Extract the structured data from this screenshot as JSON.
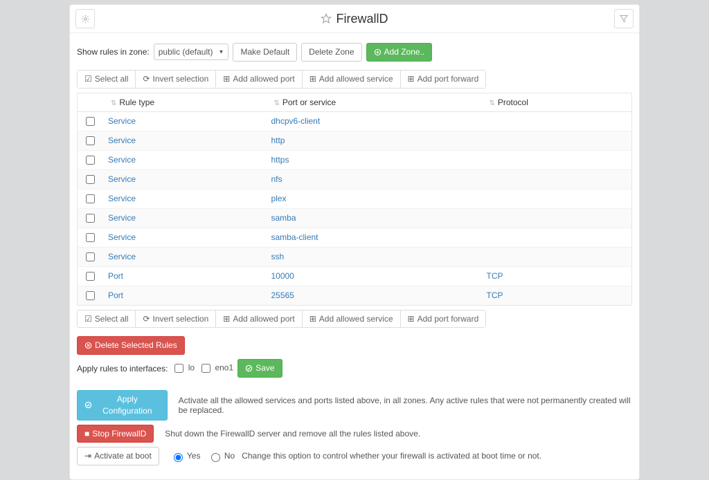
{
  "title": "FirewallD",
  "zone_label": "Show rules in zone:",
  "zone_value": "public (default)",
  "make_default": "Make Default",
  "delete_zone": "Delete Zone",
  "add_zone": "Add Zone..",
  "toolbar": {
    "select_all": "Select all",
    "invert": "Invert selection",
    "add_port": "Add allowed port",
    "add_service": "Add allowed service",
    "add_forward": "Add port forward"
  },
  "columns": {
    "rule_type": "Rule type",
    "port_service": "Port or service",
    "protocol": "Protocol"
  },
  "rules": [
    {
      "type": "Service",
      "value": "dhcpv6-client",
      "proto": ""
    },
    {
      "type": "Service",
      "value": "http",
      "proto": ""
    },
    {
      "type": "Service",
      "value": "https",
      "proto": ""
    },
    {
      "type": "Service",
      "value": "nfs",
      "proto": ""
    },
    {
      "type": "Service",
      "value": "plex",
      "proto": ""
    },
    {
      "type": "Service",
      "value": "samba",
      "proto": ""
    },
    {
      "type": "Service",
      "value": "samba-client",
      "proto": ""
    },
    {
      "type": "Service",
      "value": "ssh",
      "proto": ""
    },
    {
      "type": "Port",
      "value": "10000",
      "proto": "TCP"
    },
    {
      "type": "Port",
      "value": "25565",
      "proto": "TCP"
    }
  ],
  "delete_selected": "Delete Selected Rules",
  "apply_interfaces_label": "Apply rules to interfaces:",
  "ifaces": [
    "lo",
    "eno1"
  ],
  "save": "Save",
  "apply_conf": "Apply Configuration",
  "apply_conf_help": "Activate all the allowed services and ports listed above, in all zones. Any active rules that were not permanently created will be replaced.",
  "stop": "Stop FirewallD",
  "stop_help": "Shut down the FirewallD server and remove all the rules listed above.",
  "activate_boot": "Activate at boot",
  "yes": "Yes",
  "no": "No",
  "boot_help": "Change this option to control whether your firewall is activated at boot time or not."
}
